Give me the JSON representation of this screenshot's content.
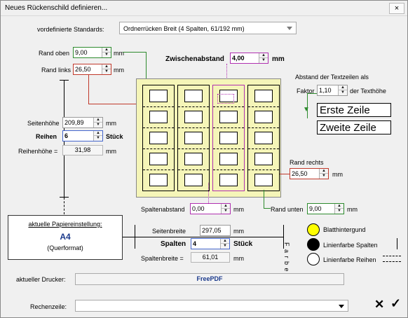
{
  "window": {
    "title": "Neues Rückenschild definieren...",
    "close_glyph": "×"
  },
  "standards": {
    "label": "vordefinierte Standards:",
    "value": "Ordnerrücken Breit (4 Spalten, 61/192 mm)"
  },
  "margins": {
    "top_label": "Rand oben",
    "top_value": "9,00",
    "top_unit": "mm",
    "left_label": "Rand links",
    "left_value": "26,50",
    "left_unit": "mm",
    "right_label": "Rand rechts",
    "right_value": "26,50",
    "right_unit": "mm",
    "bottom_label": "Rand unten",
    "bottom_value": "9,00",
    "bottom_unit": "mm"
  },
  "spacing": {
    "label": "Zwischenabstand",
    "value": "4,00",
    "unit": "mm"
  },
  "text_spacing": {
    "heading": "Abstand der Textzeilen als",
    "factor_label": "Faktor",
    "factor_value": "1,10",
    "suffix": "der Texthöhe",
    "sample_line1": "Erste Zeile",
    "sample_line2": "Zweite Zeile"
  },
  "page": {
    "height_label": "Seitenhöhe",
    "height_value": "209,89",
    "height_unit": "mm",
    "rows_label": "Reihen",
    "rows_value": "6",
    "rows_unit": "Stück",
    "row_height_label": "Reihenhöhe =",
    "row_height_value": "31,98",
    "row_height_unit": "mm",
    "width_label": "Seitenbreite",
    "width_value": "297,05",
    "width_unit": "mm",
    "cols_label": "Spalten",
    "cols_value": "4",
    "cols_unit": "Stück",
    "col_width_label": "Spaltenbreite =",
    "col_width_value": "61,01",
    "col_width_unit": "mm",
    "col_spacing_label": "Spaltenabstand",
    "col_spacing_value": "0,00",
    "col_spacing_unit": "mm"
  },
  "paper": {
    "title": "aktuelle Papiereinstellung:",
    "size": "A4",
    "orientation": "(Querformat)"
  },
  "colors": {
    "vertical_label": "F a r b e n",
    "items": [
      {
        "label": "Blatthintergund",
        "color": "#ffff00"
      },
      {
        "label": "Linienfarbe Spalten",
        "color": "#000000"
      },
      {
        "label": "Linienfarbe Reihen",
        "color": "#ffffff"
      }
    ]
  },
  "printer": {
    "label": "aktueller Drucker:",
    "value": "FreePDF"
  },
  "calc": {
    "label": "Rechenzeile:",
    "value": ""
  },
  "actions": {
    "cancel_glyph": "✕",
    "ok_glyph": "✓"
  }
}
